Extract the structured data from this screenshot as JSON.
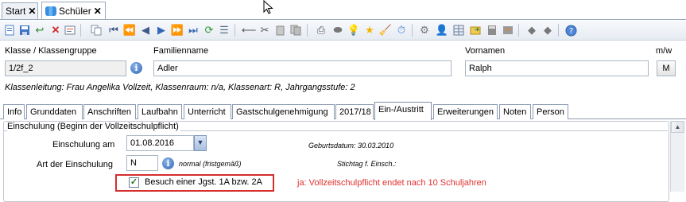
{
  "doc_tabs": [
    {
      "label": "Start",
      "close": "✕"
    },
    {
      "label": "Schüler",
      "close": "✕"
    }
  ],
  "toolbar": {
    "icons": [
      "new-icon",
      "save-icon",
      "undo-icon",
      "delete-icon",
      "properties-icon",
      "copy-icon",
      "first-icon",
      "prev-fast-icon",
      "prev-icon",
      "next-icon",
      "next-fast-icon",
      "last-icon",
      "refresh-icon",
      "list-icon",
      "back-icon",
      "cut-icon",
      "paste-icon",
      "docs-icon",
      "print-icon",
      "preview-icon",
      "idea-icon",
      "star-icon",
      "broom-icon",
      "clock-icon",
      "gear-icon",
      "person-icon",
      "grid-icon",
      "export-icon",
      "calc-icon",
      "id-card-icon",
      "shape-icon",
      "shape2-icon",
      "help-icon"
    ]
  },
  "header": {
    "klasse_label": "Klasse / Klassengruppe",
    "klasse_value": "1/2f_2",
    "familienname_label": "Familienname",
    "familienname_value": "Adler",
    "vornamen_label": "Vornamen",
    "vornamen_value": "Ralph",
    "mw_label": "m/w",
    "mw_value": "M",
    "info_glyph": "i",
    "klassenleitung": "Klassenleitung: Frau Angelika Vollzeit, Klassenraum: n/a, Klassenart: R, Jahrgangsstufe: 2"
  },
  "section_tabs": [
    "Info",
    "Grunddaten",
    "Anschriften",
    "Laufbahn",
    "Unterricht",
    "Gastschulgenehmigung",
    "2017/18",
    "Ein-/Austritt",
    "Erweiterungen",
    "Noten",
    "Person"
  ],
  "active_tab": "Ein-/Austritt",
  "einschulung": {
    "group_title": "Einschulung (Beginn der Vollzeitschulpflicht)",
    "einschulung_am_label": "Einschulung am",
    "einschulung_am_value": "01.08.2016",
    "geburtsdatum": "Geburtsdatum: 30.03.2010",
    "art_label": "Art der Einschulung",
    "art_value": "N",
    "art_hint": "normal (fristgemäß)",
    "stichtag": "Stichtag f. Einsch.:",
    "checkbox_label": "Besuch einer Jgst. 1A bzw. 2A",
    "checkbox_checked": "✓",
    "note": "ja: Vollzeitschulpflicht endet nach 10 Schuljahren"
  },
  "colors": {
    "accent": "#d62d2d",
    "note": "#e03030"
  }
}
